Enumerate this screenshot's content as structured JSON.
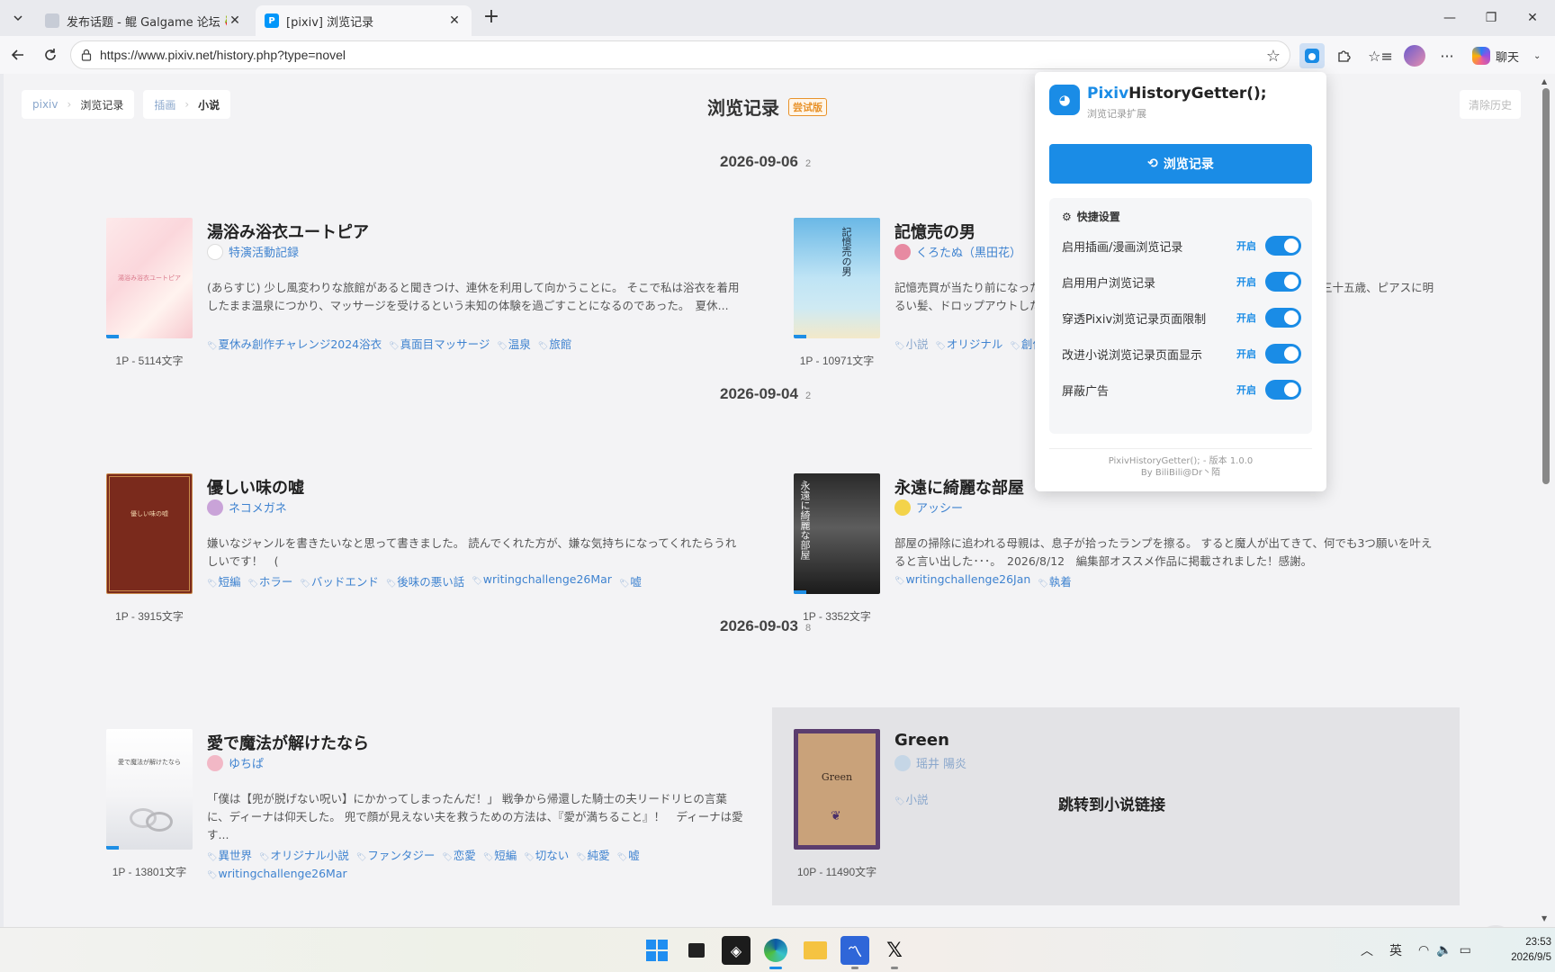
{
  "browser": {
    "tabs": [
      {
        "title": "发布话题 - 鲲 Galgame 论坛 🍓 开",
        "favicon_color": "#7a8aa0"
      },
      {
        "title": "[pixiv] 浏览记录",
        "favicon_color": "#0096fa"
      }
    ],
    "url": "https://www.pixiv.net/history.php?type=novel",
    "copilot_label": "聊天"
  },
  "page": {
    "breadcrumb": {
      "pixiv": "pixiv",
      "history": "浏览记录",
      "illust": "插画",
      "novel": "小说"
    },
    "title": "浏览记录",
    "beta_badge": "尝试版",
    "clear_button": "清除历史"
  },
  "groups": [
    {
      "date": "2026-09-06",
      "count": "2",
      "novels": [
        {
          "title": "湯浴み浴衣ユートピア",
          "author": "特演活動記録",
          "description": "(あらすじ) 少し風変わりな旅館があると聞きつけ、連休を利用して向かうことに。 そこで私は浴衣を着用したまま温泉につかり、マッサージを受けるという未知の体験を過ごすことになるのであった。　夏休...",
          "tags": [
            "夏休み創作チャレンジ2024浴衣",
            "真面目マッサージ",
            "温泉",
            "旅館"
          ],
          "meta": "1P - 5114文字",
          "cover_text": "湯浴み浴衣ユートピア"
        },
        {
          "title": "記憶売の男",
          "author": "くろたぬ（黒田花）",
          "description": "記憶売買が当たり前になった世界で、自分の記憶を切り売りして生計を立てている。三十五歳、ピアスに明るい髪、ドロップアウトしたダメ男だ。　...",
          "tags": [
            "小説",
            "オリジナル",
            "創作"
          ],
          "meta": "1P - 10971文字",
          "cover_text": "記憶売の男"
        }
      ]
    },
    {
      "date": "2026-09-04",
      "count": "2",
      "novels": [
        {
          "title": "優しい味の嘘",
          "author": "ネコメガネ",
          "description": "嫌いなジャンルを書きたいなと思って書きました。 読んでくれた方が、嫌な気持ちになってくれたらうれしいです！　(",
          "tags": [
            "短編",
            "ホラー",
            "バッドエンド",
            "後味の悪い話",
            "writingchallenge26Mar",
            "嘘"
          ],
          "meta": "1P - 3915文字",
          "cover_text": "優しい味の嘘"
        },
        {
          "title": "永遠に綺麗な部屋",
          "author": "アッシー",
          "description": "部屋の掃除に追われる母親は、息子が拾ったランプを擦る。 すると魔人が出てきて、何でも3つ願いを叶えると言い出した･･･。　2026/8/12　編集部オススメ作品に掲載されました！感謝。",
          "tags": [
            "writingchallenge26Jan",
            "執着"
          ],
          "meta": "1P - 3352文字",
          "cover_text": "永遠に綺麗な部屋"
        }
      ]
    },
    {
      "date": "2026-09-03",
      "count": "8",
      "novels": [
        {
          "title": "愛で魔法が解けたなら",
          "author": "ゆちぱ",
          "description": "「僕は【兜が脱げない呪い】にかかってしまったんだ！」 戦争から帰還した騎士の夫リードリヒの言葉に、ディーナは仰天した。 兜で顔が見えない夫を救うための方法は、『愛が満ちること』！　ディーナは愛す...",
          "tags": [
            "異世界",
            "オリジナル小説",
            "ファンタジー",
            "恋愛",
            "短編",
            "切ない",
            "純愛",
            "嘘",
            "writingchallenge26Mar"
          ],
          "meta": "1P - 13801文字",
          "cover_text": "愛で魔法が解けたなら"
        },
        {
          "title": "Green",
          "author": "瑶井 陽炎",
          "description": "",
          "tags": [
            "小説"
          ],
          "meta": "10P - 11490文字",
          "cover_text": "Green",
          "overlay": "跳转到小说链接"
        }
      ]
    }
  ],
  "popup": {
    "name_prefix": "Pixiv",
    "name_suffix": "HistoryGetter();",
    "subtitle": "浏览记录扩展",
    "main_button": "浏览记录",
    "settings_header": "快捷设置",
    "settings": [
      {
        "label": "启用插画/漫画浏览记录",
        "state": "开启"
      },
      {
        "label": "启用用户浏览记录",
        "state": "开启"
      },
      {
        "label": "穿透Pixiv浏览记录页面限制",
        "state": "开启"
      },
      {
        "label": "改进小说浏览记录页面显示",
        "state": "开启"
      },
      {
        "label": "屏蔽广告",
        "state": "开启"
      }
    ],
    "footer_version": "PixivHistoryGetter(); - 版本 1.0.0",
    "footer_author": "By BiliBili@Dr丶陌"
  },
  "taskbar": {
    "ime": "英",
    "time": "23:53",
    "date": "2026/9/5"
  },
  "colors": {
    "accent": "#1a8ce6",
    "link": "#3f83d0",
    "beta": "#e8922a"
  }
}
